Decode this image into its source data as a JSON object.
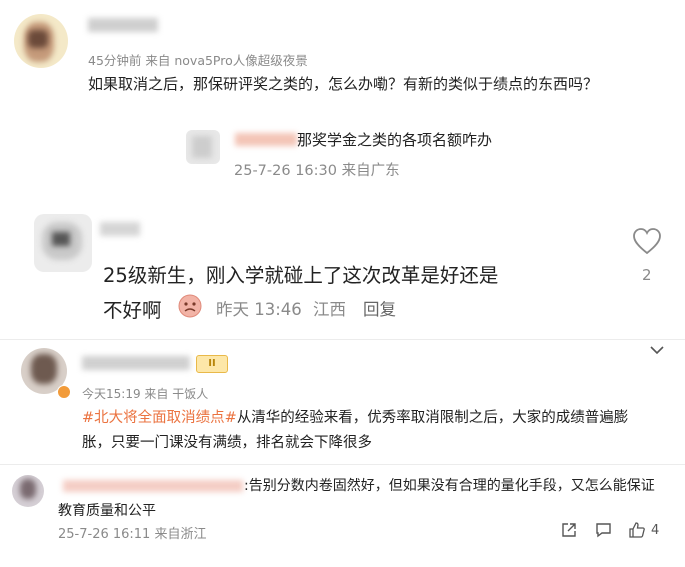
{
  "comment1": {
    "meta": "45分钟前  来自 nova5Pro人像超级夜景",
    "text": "如果取消之后，那保研评奖之类的，怎么办嘞？有新的类似于绩点的东西吗？"
  },
  "reply1": {
    "text": "那奖学金之类的各项名额咋办",
    "meta": "25-7-26 16:30 来自广东"
  },
  "comment2": {
    "line1": "25级新生，刚入学就碰上了这次改革是好还是",
    "line2": "不好啊",
    "meta_time": "昨天 13:46",
    "meta_loc": "江西",
    "reply_label": "回复",
    "like_count": "2"
  },
  "comment3": {
    "badge": "II",
    "meta": "今天15:19  来自 干饭人",
    "hashtag": "#北大将全面取消绩点#",
    "text_a": "从清华的经验来看，优秀率取消限制之后，大家的成绩普遍膨",
    "text_b": "胀，只要一门课没有满绩，排名就会下降很多"
  },
  "comment4": {
    "line1": ":告别分数内卷固然好，但如果没有合理的量化手段，又怎么能保证",
    "line2": "教育质量和公平",
    "meta": "25-7-26 16:11 来自浙江",
    "like_count": "4"
  },
  "colors": {
    "hashtag": "#eb7340",
    "meta": "#8a8a8a",
    "text": "#222222"
  }
}
